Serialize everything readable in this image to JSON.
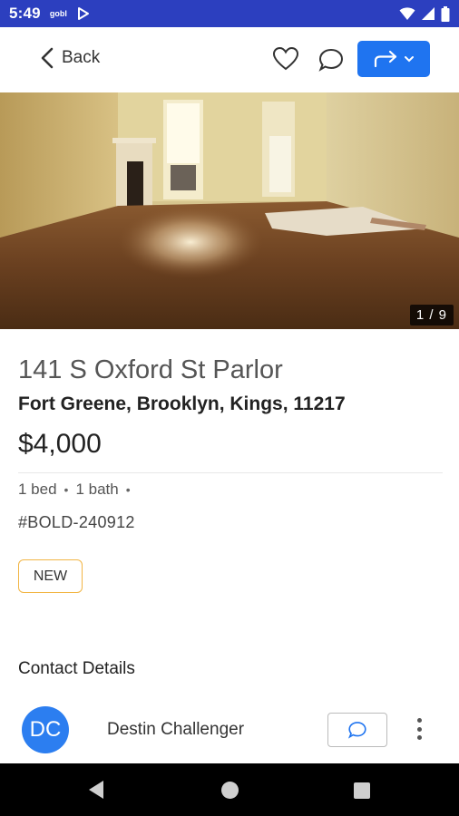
{
  "status_bar": {
    "time": "5:49",
    "app_label": "gobl"
  },
  "header": {
    "back_label": "Back"
  },
  "photo": {
    "counter": "1 / 9"
  },
  "listing": {
    "title": "141 S Oxford St Parlor",
    "location": "Fort Greene, Brooklyn, Kings, 11217",
    "price": "$4,000",
    "beds": "1 bed",
    "baths": "1 bath",
    "listing_id": "#BOLD-240912",
    "badge": "NEW"
  },
  "contact": {
    "section_title": "Contact Details",
    "initials": "DC",
    "name": "Destin Challenger"
  },
  "colors": {
    "status_bar": "#2c3fbf",
    "accent": "#1f74f0",
    "badge_border": "#f2b544",
    "avatar": "#2c7ef0"
  }
}
